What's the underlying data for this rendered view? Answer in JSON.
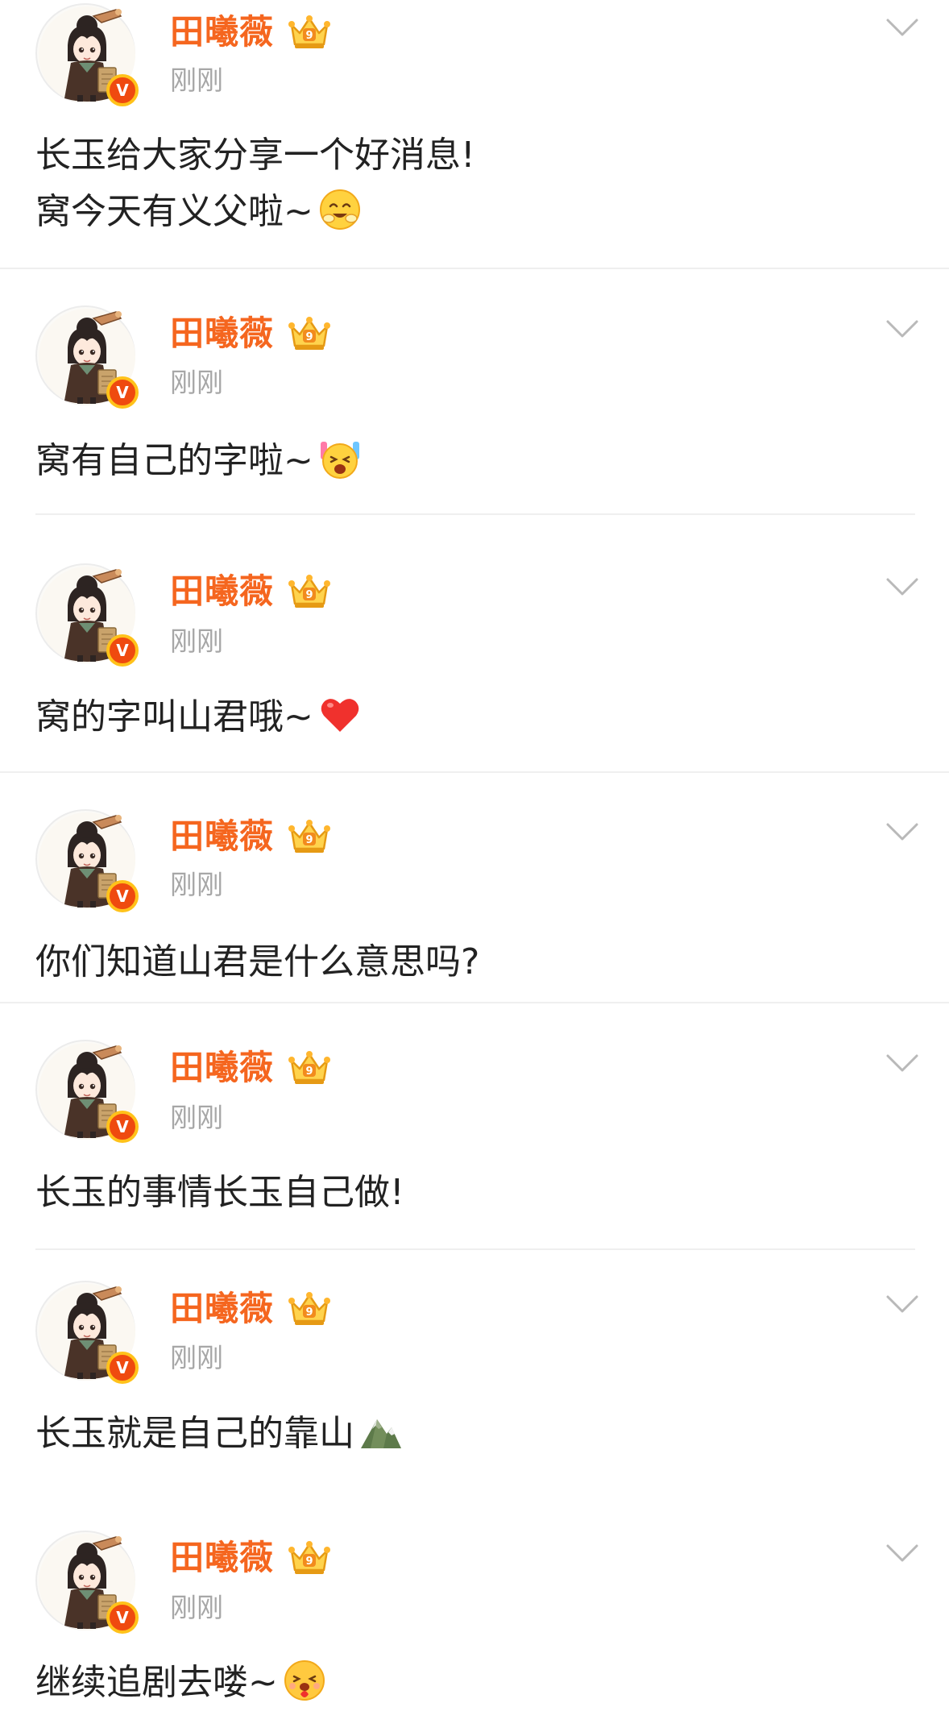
{
  "posts": [
    {
      "author": "田曦薇",
      "time": "刚刚",
      "verified_label": "V",
      "level_badge": "crown-level-icon",
      "lines": [
        "长玉给大家分享一个好消息!",
        "窝今天有义父啦~"
      ],
      "emoji": "smiling-face-emoji"
    },
    {
      "author": "田曦薇",
      "time": "刚刚",
      "verified_label": "V",
      "level_badge": "crown-level-icon",
      "lines": [
        "窝有自己的字啦~"
      ],
      "emoji": "cheering-face-emoji"
    },
    {
      "author": "田曦薇",
      "time": "刚刚",
      "verified_label": "V",
      "level_badge": "crown-level-icon",
      "lines": [
        "窝的字叫山君哦~"
      ],
      "emoji": "red-heart-emoji"
    },
    {
      "author": "田曦薇",
      "time": "刚刚",
      "verified_label": "V",
      "level_badge": "crown-level-icon",
      "lines": [
        "你们知道山君是什么意思吗?"
      ],
      "emoji": ""
    },
    {
      "author": "田曦薇",
      "time": "刚刚",
      "verified_label": "V",
      "level_badge": "crown-level-icon",
      "lines": [
        "长玉的事情长玉自己做!"
      ],
      "emoji": ""
    },
    {
      "author": "田曦薇",
      "time": "刚刚",
      "verified_label": "V",
      "level_badge": "crown-level-icon",
      "lines": [
        "长玉就是自己的靠山"
      ],
      "emoji": "mountain-emoji"
    },
    {
      "author": "田曦薇",
      "time": "刚刚",
      "verified_label": "V",
      "level_badge": "crown-level-icon",
      "lines": [
        "继续追剧去喽~"
      ],
      "emoji": "hugging-face-emoji"
    }
  ],
  "colors": {
    "author": "#f5661f",
    "time": "#a7a7a7",
    "text": "#222222",
    "verified": "#ef4a0f",
    "divider": "#efefef"
  }
}
